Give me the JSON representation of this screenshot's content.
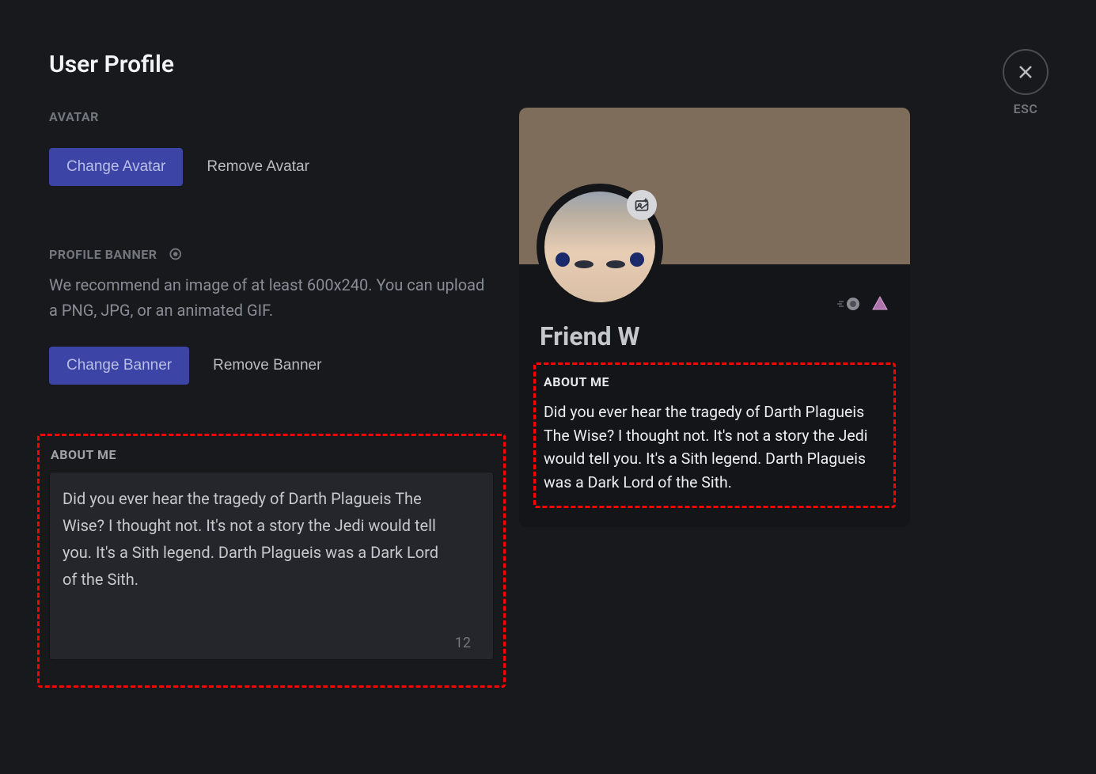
{
  "page": {
    "title": "User Profile",
    "esc_label": "ESC"
  },
  "avatar": {
    "header": "AVATAR",
    "change_label": "Change Avatar",
    "remove_label": "Remove Avatar"
  },
  "banner": {
    "header": "PROFILE BANNER",
    "hint": "We recommend an image of at least 600x240. You can upload a PNG, JPG, or an animated GIF.",
    "change_label": "Change Banner",
    "remove_label": "Remove Banner"
  },
  "about": {
    "header": "ABOUT ME",
    "text": "Did you ever hear the tragedy of Darth Plagueis The Wise? I thought not. It's not a story the Jedi would tell you. It's a Sith legend. Darth Plagueis was a Dark Lord of the Sith.",
    "char_remaining": "12"
  },
  "preview": {
    "username": "Friend W",
    "about_header": "ABOUT ME",
    "about_text": "Did you ever hear the tragedy of Darth Plagueis The Wise? I thought not. It's not a story the Jedi would tell you. It's a Sith legend. Darth Plagueis was a Dark Lord of the Sith.",
    "banner_color": "#7e6d5a"
  }
}
